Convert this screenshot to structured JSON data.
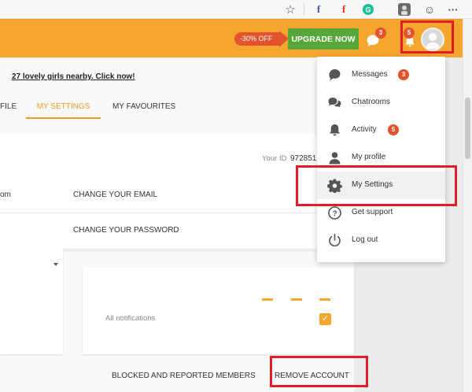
{
  "browser_toolbar": {
    "icons": [
      "star-icon",
      "facebook-icon",
      "flipboard-icon",
      "grammarly-icon",
      "extension-avatar-icon",
      "smiley-icon",
      "more-icon"
    ],
    "more_label": "···"
  },
  "header": {
    "discount_label": "-30% OFF",
    "upgrade_label": "UPGRADE NOW",
    "chat_badge": "3",
    "notif_badge": "5",
    "colors": {
      "header": "#f5a62f",
      "upgrade": "#56a63a",
      "badge": "#e2532e",
      "highlight": "#e31d27"
    }
  },
  "promo": {
    "link_text": "27 lovely girls nearby. Click now!"
  },
  "tabs": [
    {
      "label": "FILE",
      "active": false
    },
    {
      "label": "MY SETTINGS",
      "active": true
    },
    {
      "label": "MY FAVOURITES",
      "active": false
    }
  ],
  "settings": {
    "your_id_label": "Your ID",
    "your_id_value": "972851",
    "email_left_fragment": "om",
    "change_email_label": "CHANGE YOUR EMAIL",
    "change_password_label": "CHANGE YOUR PASSWORD",
    "all_notifications_label": "All notifications",
    "all_notifications_checked": true
  },
  "bottom_links": {
    "blocked_label": "BLOCKED AND REPORTED MEMBERS",
    "remove_label": "REMOVE ACCOUNT"
  },
  "dropdown": {
    "items": [
      {
        "label": "Messages",
        "icon": "chat-bubble-icon",
        "badge": "3"
      },
      {
        "label": "Chatrooms",
        "icon": "chatrooms-icon",
        "badge": ""
      },
      {
        "label": "Activity",
        "icon": "bell-icon",
        "badge": "5"
      },
      {
        "label": "My profile",
        "icon": "person-icon",
        "badge": ""
      },
      {
        "label": "My Settings",
        "icon": "gear-icon",
        "badge": ""
      },
      {
        "label": "Get support",
        "icon": "question-icon",
        "badge": ""
      },
      {
        "label": "Log out",
        "icon": "power-icon",
        "badge": ""
      }
    ]
  }
}
